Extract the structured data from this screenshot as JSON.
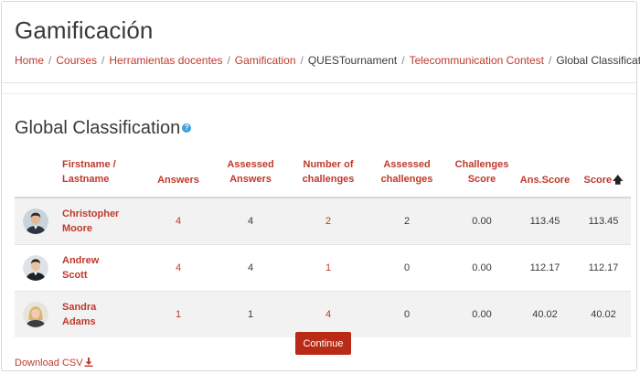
{
  "page": {
    "title": "Gamificación",
    "breadcrumb": [
      {
        "label": "Home",
        "link": true
      },
      {
        "label": "Courses",
        "link": true
      },
      {
        "label": "Herramientas docentes",
        "link": true
      },
      {
        "label": "Gamification",
        "link": true
      },
      {
        "label": "QUESTournament",
        "link": false
      },
      {
        "label": "Telecommunication Contest",
        "link": true
      },
      {
        "label": "Global Classification",
        "link": false
      }
    ]
  },
  "section": {
    "title": "Global Classification",
    "help_icon": "question-circle-icon"
  },
  "table": {
    "headers": {
      "name_line1": "Firstname /",
      "name_line2": "Lastname",
      "answers": "Answers",
      "assessed_answers_1": "Assessed",
      "assessed_answers_2": "Answers",
      "num_challenges_1": "Number of",
      "num_challenges_2": "challenges",
      "assessed_challenges_1": "Assessed",
      "assessed_challenges_2": "challenges",
      "challenges_score_1": "Challenges",
      "challenges_score_2": "Score",
      "ans_score": "Ans.Score",
      "score": "Score",
      "sort_icon": "arrow-up-icon"
    },
    "rows": [
      {
        "first": "Christopher",
        "last": "Moore",
        "answers": "4",
        "assessed_answers": "4",
        "challenges": "2",
        "assessed_challenges": "2",
        "challenges_score": "0.00",
        "ans_score": "113.45",
        "score": "113.45"
      },
      {
        "first": "Andrew",
        "last": "Scott",
        "answers": "4",
        "assessed_answers": "4",
        "challenges": "1",
        "assessed_challenges": "0",
        "challenges_score": "0.00",
        "ans_score": "112.17",
        "score": "112.17"
      },
      {
        "first": "Sandra",
        "last": "Adams",
        "answers": "1",
        "assessed_answers": "1",
        "challenges": "4",
        "assessed_challenges": "0",
        "challenges_score": "0.00",
        "ans_score": "40.02",
        "score": "40.02"
      }
    ]
  },
  "actions": {
    "continue_label": "Continue",
    "download_label": "Download CSV",
    "download_icon": "download-icon"
  },
  "colors": {
    "accent": "#c0392b",
    "button": "#b92b16",
    "help": "#3b9fd6"
  }
}
